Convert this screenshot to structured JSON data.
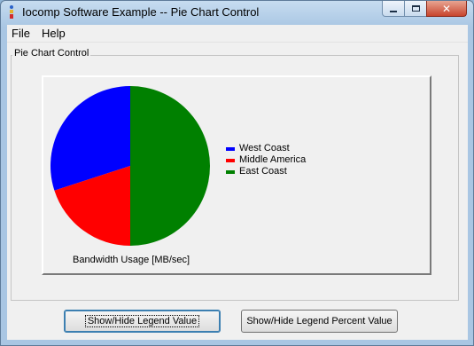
{
  "window": {
    "title": "Iocomp Software Example -- Pie Chart Control",
    "controls": {
      "minimize": "",
      "maximize": "",
      "close": "✕"
    }
  },
  "menu": {
    "items": [
      "File",
      "Help"
    ]
  },
  "group": {
    "label": "Pie Chart Control"
  },
  "buttons": {
    "legend_value": "Show/Hide Legend Value",
    "legend_percent": "Show/Hide Legend Percent Value"
  },
  "chart_data": {
    "type": "pie",
    "title": "Bandwidth Usage [MB/sec]",
    "slices": [
      {
        "label": "West Coast",
        "value": 30,
        "color": "#0000ff"
      },
      {
        "label": "Middle America",
        "value": 20,
        "color": "#ff0000"
      },
      {
        "label": "East Coast",
        "value": 50,
        "color": "#008000"
      }
    ],
    "legend_placement": "right"
  }
}
